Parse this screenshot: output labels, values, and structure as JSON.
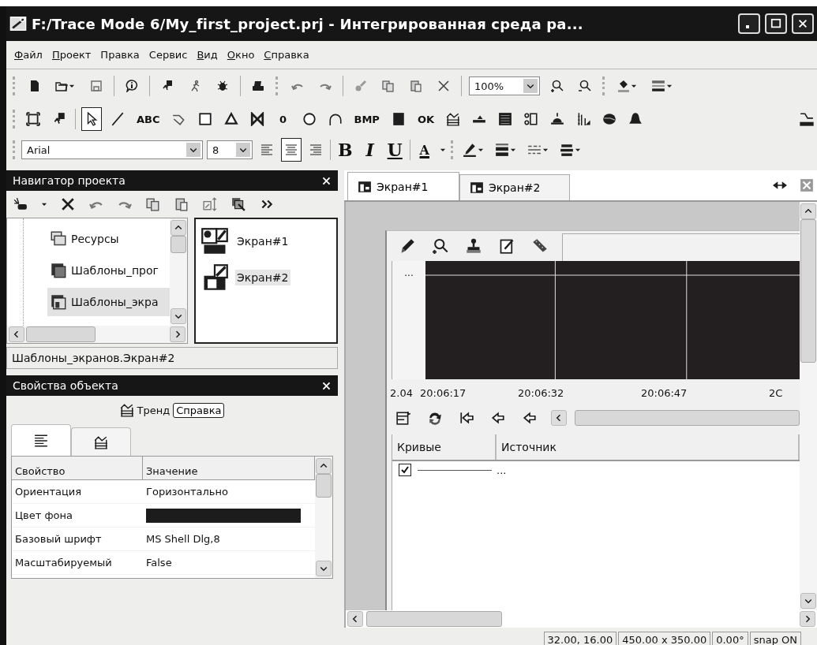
{
  "window": {
    "title": "F:/Trace Mode 6/My_first_project.prj - Интегрированная среда ра..."
  },
  "menu": [
    {
      "label": "Файл",
      "mnemonic": true
    },
    {
      "label": "Проект",
      "mnemonic": true
    },
    {
      "label": "Правка",
      "mnemonic": false
    },
    {
      "label": "Сервис",
      "mnemonic": false
    },
    {
      "label": "Вид",
      "mnemonic": true
    },
    {
      "label": "Окно",
      "mnemonic": true
    },
    {
      "label": "Справка",
      "mnemonic": true
    }
  ],
  "standard_toolbar": {
    "zoom": "100%"
  },
  "objects_toolbar": [
    {
      "selected": false
    },
    {
      "selected": false
    },
    {
      "selected": true
    },
    {
      "selected": false
    },
    {
      "label": "ABC",
      "selected": false
    },
    {
      "selected": false
    },
    {
      "selected": false
    },
    {
      "selected": false
    },
    {
      "selected": false
    },
    {
      "label": "0",
      "selected": false
    },
    {
      "selected": false
    },
    {
      "selected": false
    },
    {
      "label": "BMP",
      "selected": false
    },
    {
      "selected": false
    },
    {
      "label": "OK",
      "selected": false
    },
    {
      "selected": false
    },
    {
      "selected": false
    },
    {
      "selected": false
    },
    {
      "selected": false
    },
    {
      "selected": false
    },
    {
      "selected": false
    },
    {
      "selected": false
    },
    {
      "selected": false
    },
    {
      "selected": false
    }
  ],
  "format_toolbar": {
    "font": "Arial",
    "size": "8",
    "align": [
      {
        "selected": false
      },
      {
        "selected": true
      },
      {
        "selected": false
      }
    ],
    "styles": [
      "B",
      "I",
      "U"
    ],
    "color_letter": "A"
  },
  "navigator": {
    "title": "Навигатор проекта",
    "tree": [
      {
        "label": "Ресурсы",
        "selected": false
      },
      {
        "label": "Шаблоны_прог",
        "selected": false
      },
      {
        "label": "Шаблоны_экра",
        "selected": true
      }
    ],
    "items": [
      {
        "label": "Экран#1",
        "selected": false
      },
      {
        "label": "Экран#2",
        "selected": true
      }
    ],
    "path": "Шаблоны_экранов.Экран#2"
  },
  "properties": {
    "title": "Свойства объекта",
    "object": "Тренд",
    "help_button": "Справка",
    "tabs": [
      {
        "selected": true
      },
      {
        "selected": false
      }
    ],
    "columns": [
      "Свойство",
      "Значение"
    ],
    "rows": [
      {
        "name": "Ориентация",
        "kind": "text",
        "value": "Горизонтально"
      },
      {
        "name": "Цвет фона",
        "kind": "color",
        "color": "#1c1c1c"
      },
      {
        "name": "Базовый шрифт",
        "kind": "text",
        "value": "MS Shell Dlg,8"
      },
      {
        "name": "Масштабируемый",
        "kind": "text",
        "value": "False"
      }
    ]
  },
  "document_tabs": [
    {
      "label": "Экран#1",
      "selected": true
    },
    {
      "label": "Экран#2",
      "selected": false
    }
  ],
  "trend": {
    "legend_mark": "...",
    "time_labels": [
      "2.04",
      "20:06:17",
      "20:06:32",
      "20:06:47",
      "2C"
    ],
    "columns": [
      "Кривые",
      "Источник"
    ],
    "curves": [
      {
        "checked": true,
        "source": "..."
      }
    ]
  },
  "status_bar": [
    "32.00, 16.00",
    "450.00 x 350.00",
    "0.00°",
    "snap ON"
  ]
}
